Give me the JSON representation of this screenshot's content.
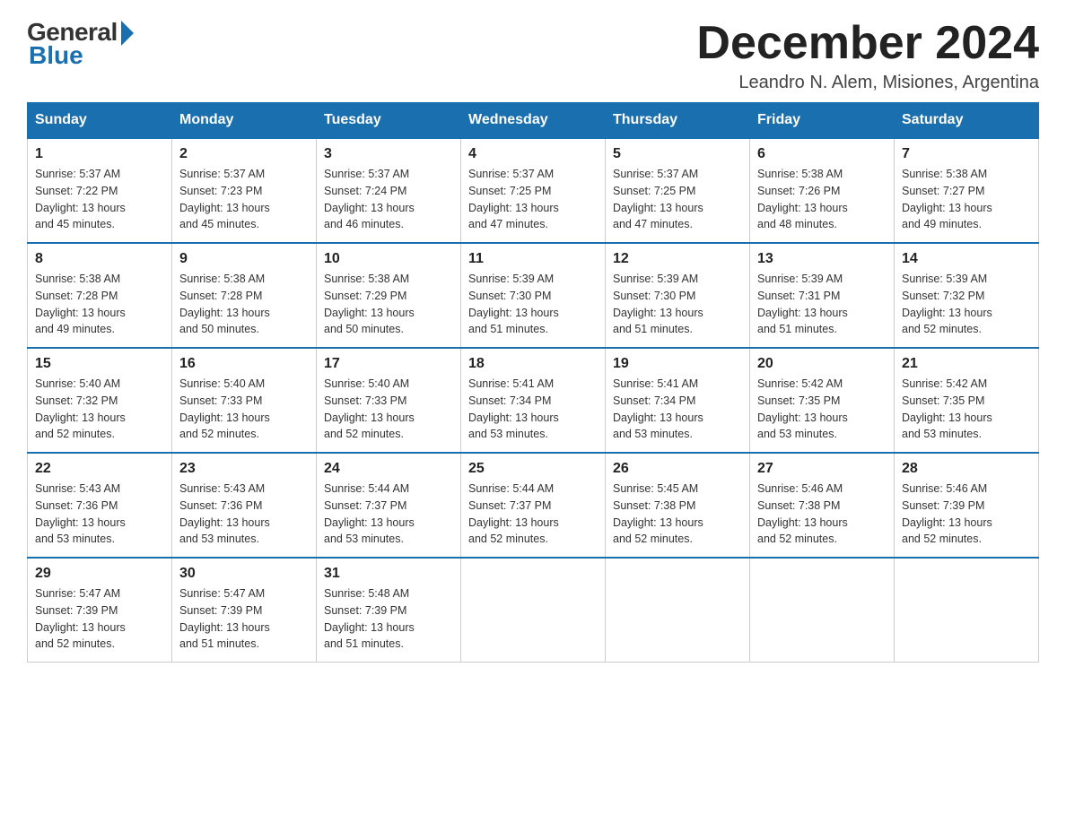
{
  "logo": {
    "general": "General",
    "blue": "Blue"
  },
  "title": "December 2024",
  "location": "Leandro N. Alem, Misiones, Argentina",
  "headers": [
    "Sunday",
    "Monday",
    "Tuesday",
    "Wednesday",
    "Thursday",
    "Friday",
    "Saturday"
  ],
  "weeks": [
    [
      {
        "day": "1",
        "sunrise": "5:37 AM",
        "sunset": "7:22 PM",
        "daylight": "13 hours and 45 minutes."
      },
      {
        "day": "2",
        "sunrise": "5:37 AM",
        "sunset": "7:23 PM",
        "daylight": "13 hours and 45 minutes."
      },
      {
        "day": "3",
        "sunrise": "5:37 AM",
        "sunset": "7:24 PM",
        "daylight": "13 hours and 46 minutes."
      },
      {
        "day": "4",
        "sunrise": "5:37 AM",
        "sunset": "7:25 PM",
        "daylight": "13 hours and 47 minutes."
      },
      {
        "day": "5",
        "sunrise": "5:37 AM",
        "sunset": "7:25 PM",
        "daylight": "13 hours and 47 minutes."
      },
      {
        "day": "6",
        "sunrise": "5:38 AM",
        "sunset": "7:26 PM",
        "daylight": "13 hours and 48 minutes."
      },
      {
        "day": "7",
        "sunrise": "5:38 AM",
        "sunset": "7:27 PM",
        "daylight": "13 hours and 49 minutes."
      }
    ],
    [
      {
        "day": "8",
        "sunrise": "5:38 AM",
        "sunset": "7:28 PM",
        "daylight": "13 hours and 49 minutes."
      },
      {
        "day": "9",
        "sunrise": "5:38 AM",
        "sunset": "7:28 PM",
        "daylight": "13 hours and 50 minutes."
      },
      {
        "day": "10",
        "sunrise": "5:38 AM",
        "sunset": "7:29 PM",
        "daylight": "13 hours and 50 minutes."
      },
      {
        "day": "11",
        "sunrise": "5:39 AM",
        "sunset": "7:30 PM",
        "daylight": "13 hours and 51 minutes."
      },
      {
        "day": "12",
        "sunrise": "5:39 AM",
        "sunset": "7:30 PM",
        "daylight": "13 hours and 51 minutes."
      },
      {
        "day": "13",
        "sunrise": "5:39 AM",
        "sunset": "7:31 PM",
        "daylight": "13 hours and 51 minutes."
      },
      {
        "day": "14",
        "sunrise": "5:39 AM",
        "sunset": "7:32 PM",
        "daylight": "13 hours and 52 minutes."
      }
    ],
    [
      {
        "day": "15",
        "sunrise": "5:40 AM",
        "sunset": "7:32 PM",
        "daylight": "13 hours and 52 minutes."
      },
      {
        "day": "16",
        "sunrise": "5:40 AM",
        "sunset": "7:33 PM",
        "daylight": "13 hours and 52 minutes."
      },
      {
        "day": "17",
        "sunrise": "5:40 AM",
        "sunset": "7:33 PM",
        "daylight": "13 hours and 52 minutes."
      },
      {
        "day": "18",
        "sunrise": "5:41 AM",
        "sunset": "7:34 PM",
        "daylight": "13 hours and 53 minutes."
      },
      {
        "day": "19",
        "sunrise": "5:41 AM",
        "sunset": "7:34 PM",
        "daylight": "13 hours and 53 minutes."
      },
      {
        "day": "20",
        "sunrise": "5:42 AM",
        "sunset": "7:35 PM",
        "daylight": "13 hours and 53 minutes."
      },
      {
        "day": "21",
        "sunrise": "5:42 AM",
        "sunset": "7:35 PM",
        "daylight": "13 hours and 53 minutes."
      }
    ],
    [
      {
        "day": "22",
        "sunrise": "5:43 AM",
        "sunset": "7:36 PM",
        "daylight": "13 hours and 53 minutes."
      },
      {
        "day": "23",
        "sunrise": "5:43 AM",
        "sunset": "7:36 PM",
        "daylight": "13 hours and 53 minutes."
      },
      {
        "day": "24",
        "sunrise": "5:44 AM",
        "sunset": "7:37 PM",
        "daylight": "13 hours and 53 minutes."
      },
      {
        "day": "25",
        "sunrise": "5:44 AM",
        "sunset": "7:37 PM",
        "daylight": "13 hours and 52 minutes."
      },
      {
        "day": "26",
        "sunrise": "5:45 AM",
        "sunset": "7:38 PM",
        "daylight": "13 hours and 52 minutes."
      },
      {
        "day": "27",
        "sunrise": "5:46 AM",
        "sunset": "7:38 PM",
        "daylight": "13 hours and 52 minutes."
      },
      {
        "day": "28",
        "sunrise": "5:46 AM",
        "sunset": "7:39 PM",
        "daylight": "13 hours and 52 minutes."
      }
    ],
    [
      {
        "day": "29",
        "sunrise": "5:47 AM",
        "sunset": "7:39 PM",
        "daylight": "13 hours and 52 minutes."
      },
      {
        "day": "30",
        "sunrise": "5:47 AM",
        "sunset": "7:39 PM",
        "daylight": "13 hours and 51 minutes."
      },
      {
        "day": "31",
        "sunrise": "5:48 AM",
        "sunset": "7:39 PM",
        "daylight": "13 hours and 51 minutes."
      },
      null,
      null,
      null,
      null
    ]
  ],
  "labels": {
    "sunrise": "Sunrise:",
    "sunset": "Sunset:",
    "daylight": "Daylight:"
  }
}
